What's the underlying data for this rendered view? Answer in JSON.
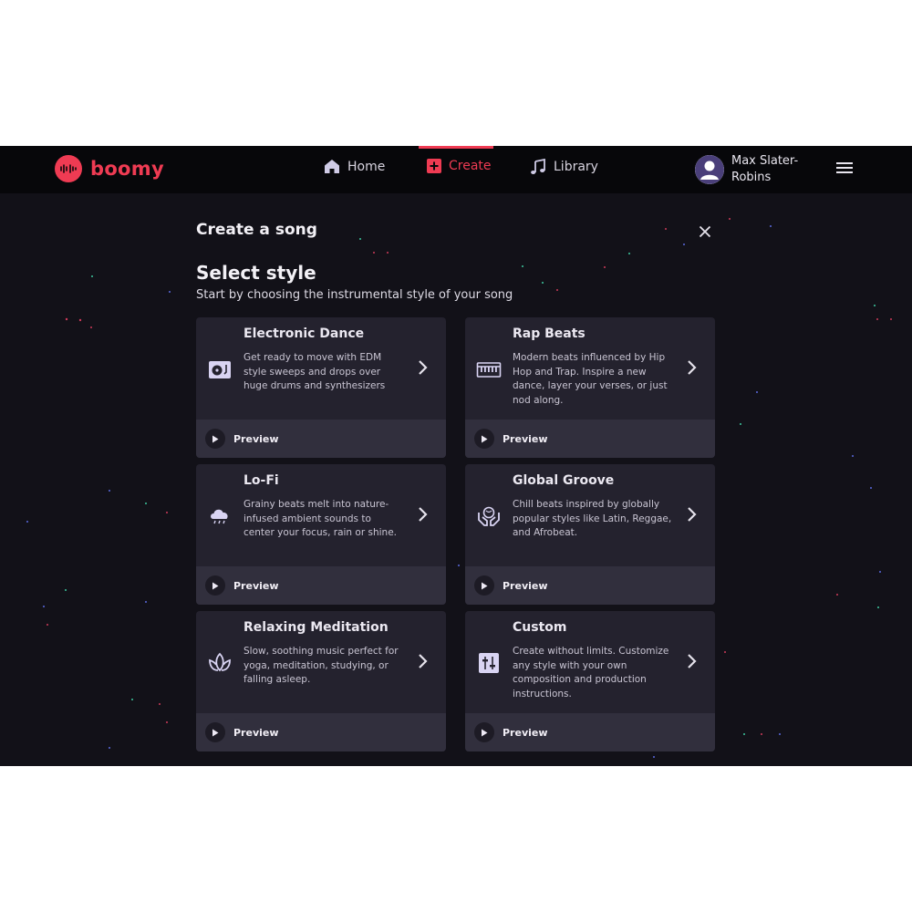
{
  "brand": {
    "name": "boomy",
    "accent": "#ef3b53"
  },
  "nav": {
    "items": [
      {
        "label": "Home",
        "icon": "home-icon"
      },
      {
        "label": "Create",
        "icon": "plus-square-icon",
        "active": true
      },
      {
        "label": "Library",
        "icon": "music-note-icon"
      }
    ]
  },
  "user": {
    "name_line1": "Max Slater-",
    "name_line2": "Robins"
  },
  "modal": {
    "title": "Create a song",
    "section_title": "Select style",
    "section_subtitle": "Start by choosing the instrumental style of your song",
    "preview_label": "Preview",
    "styles": [
      {
        "title": "Electronic Dance",
        "icon": "turntable-icon",
        "description": "Get ready to move with EDM style sweeps and drops over huge drums and synthesizers"
      },
      {
        "title": "Rap Beats",
        "icon": "keyboard-icon",
        "description": "Modern beats influenced by Hip Hop and Trap. Inspire a new dance, layer your verses, or just nod along."
      },
      {
        "title": "Lo-Fi",
        "icon": "cloud-rain-icon",
        "description": "Grainy beats melt into nature-infused ambient sounds to center your focus, rain or shine."
      },
      {
        "title": "Global Groove",
        "icon": "globe-hands-icon",
        "description": "Chill beats inspired by globally popular styles like Latin, Reggae, and Afrobeat."
      },
      {
        "title": "Relaxing Meditation",
        "icon": "lotus-icon",
        "description": "Slow, soothing music perfect for yoga, meditation, studying, or falling asleep."
      },
      {
        "title": "Custom",
        "icon": "sliders-icon",
        "description": "Create without limits. Customize any style with your own composition and production instructions."
      }
    ]
  }
}
